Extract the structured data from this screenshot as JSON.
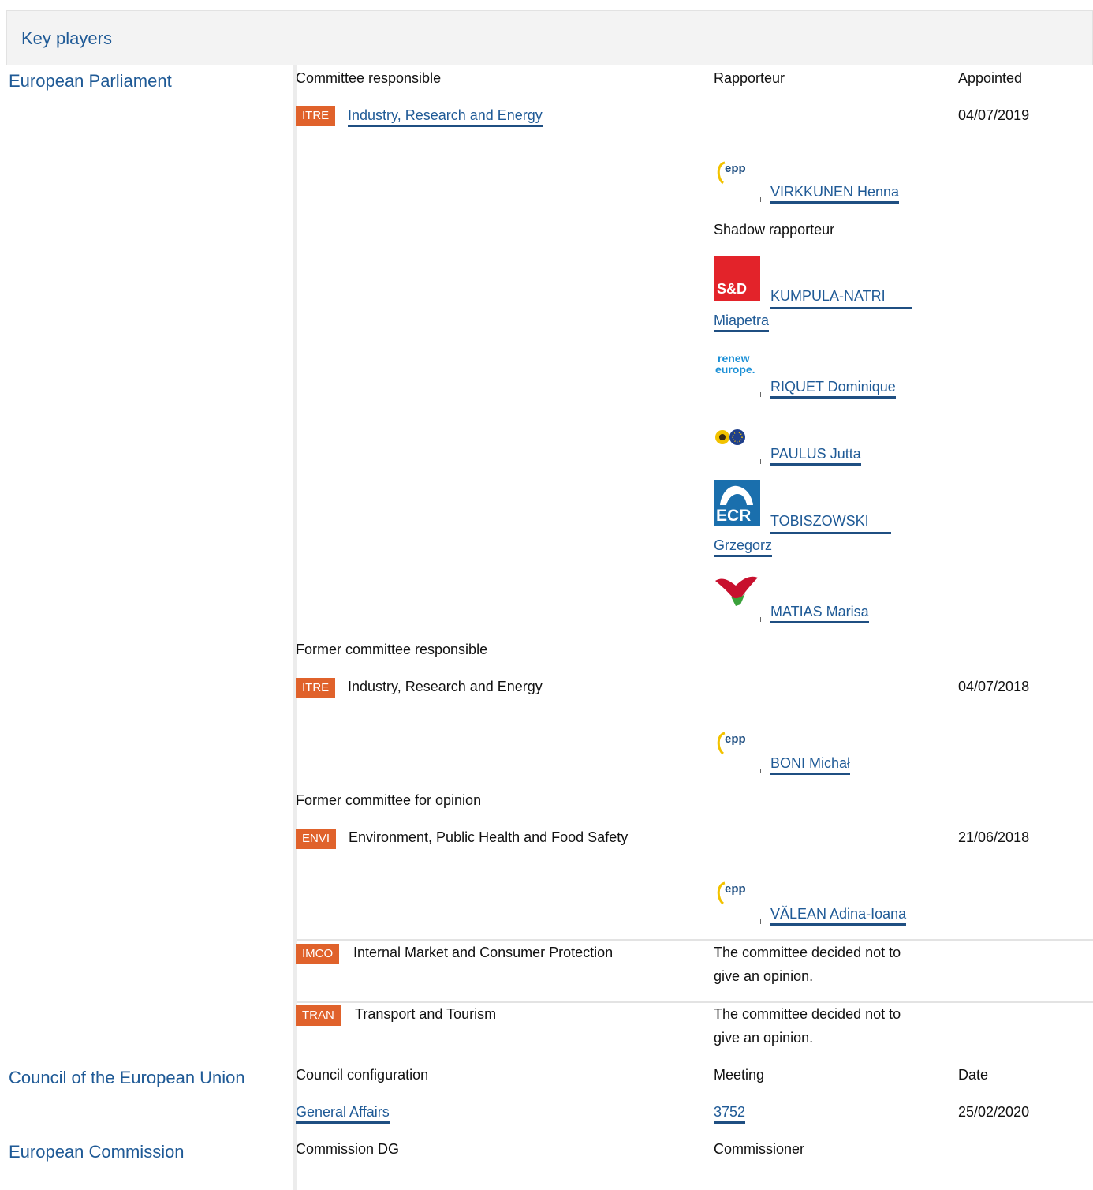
{
  "header": {
    "title": "Key players"
  },
  "institutions": {
    "ep": "European Parliament",
    "council": "Council of the European Union",
    "commission": "European Commission"
  },
  "ep": {
    "col_committee": "Committee responsible",
    "col_rapporteur": "Rapporteur",
    "col_appointed": "Appointed",
    "main": {
      "badge": "ITRE",
      "name": "Industry, Research and Energy",
      "date": "04/07/2019"
    },
    "rapporteur": {
      "group_icon": "epp-logo",
      "name": "VIRKKUNEN Henna"
    },
    "shadow_label": "Shadow rapporteur",
    "shadows": [
      {
        "group_icon": "sd-logo",
        "label": "S&D",
        "name_line1": "KUMPULA-NATRI",
        "name_line2": "Miapetra"
      },
      {
        "group_icon": "renew-logo",
        "label_line1": "renew",
        "label_line2": "europe.",
        "name": "RIQUET Dominique"
      },
      {
        "group_icon": "greens-logo",
        "name": "PAULUS Jutta"
      },
      {
        "group_icon": "ecr-logo",
        "label": "ECR",
        "name_line1": "TOBISZOWSKI",
        "name_line2": "Grzegorz"
      },
      {
        "group_icon": "left-logo",
        "name": "MATIAS Marisa"
      }
    ],
    "former_responsible_label": "Former committee responsible",
    "former_responsible": {
      "badge": "ITRE",
      "name": "Industry, Research and Energy",
      "date": "04/07/2018",
      "rapporteur": "BONI Michał"
    },
    "former_opinion_label": "Former committee for opinion",
    "former_opinion": [
      {
        "badge": "ENVI",
        "name": "Environment, Public Health and Food Safety",
        "date": "21/06/2018",
        "rapporteur": "VĂLEAN Adina-Ioana"
      },
      {
        "badge": "IMCO",
        "name": "Internal Market and Consumer Protection",
        "note_line1": "The committee decided not to",
        "note_line2": "give an opinion."
      },
      {
        "badge": "TRAN",
        "name": "Transport and Tourism",
        "note_line1": "The committee decided not to",
        "note_line2": "give an opinion."
      }
    ],
    "epp_label": "epp"
  },
  "council": {
    "col_config": "Council configuration",
    "col_meeting": "Meeting",
    "col_date": "Date",
    "config": "General Affairs",
    "meeting": "3752",
    "date": "25/02/2020"
  },
  "commission": {
    "col_dg": "Commission DG",
    "col_commissioner": "Commissioner"
  },
  "colors": {
    "accent": "#1f5a96",
    "badge": "#e0622b",
    "sd": "#e3232a",
    "ecr": "#1a6fad"
  }
}
